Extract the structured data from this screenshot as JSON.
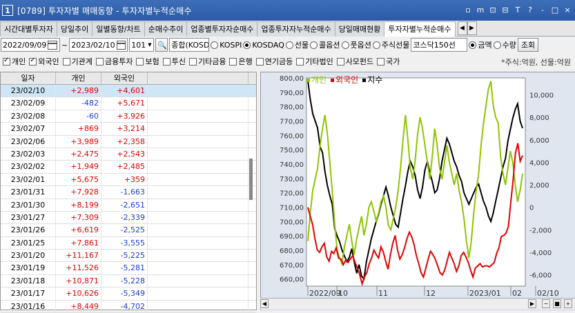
{
  "window": {
    "badge": "1",
    "title": "[0789] 투자자별 매매동향 - 투자자별누적순매수",
    "controls": [
      "▫",
      "m",
      "⊡",
      "⊟",
      "T",
      "?",
      "-",
      "□",
      "×"
    ]
  },
  "tabs": [
    "시간대별투자자",
    "당일추이",
    "일별동향/차트",
    "순매수추이",
    "업종별투자자순매수",
    "업종투자자누적순매수",
    "당일매매현황",
    "투자자별누적순매수"
  ],
  "active_tab": 7,
  "controls": {
    "date_from": "2022/09/09",
    "tilde": "~",
    "date_to": "2023/02/10",
    "code": "101",
    "market_select": "종합(KOSD",
    "radios": [
      {
        "label": "KOSPI",
        "on": false
      },
      {
        "label": "KOSDAQ",
        "on": true
      },
      {
        "label": "선물",
        "on": false
      },
      {
        "label": "콜옵션",
        "on": false
      },
      {
        "label": "풋옵션",
        "on": false
      },
      {
        "label": "주식선물",
        "on": false
      }
    ],
    "sector_select": "코스닥150선",
    "value_radios": [
      {
        "label": "금액",
        "on": true
      },
      {
        "label": "수량",
        "on": false
      }
    ],
    "query_button": "조회"
  },
  "checkboxes": [
    {
      "label": "개인",
      "on": true
    },
    {
      "label": "외국인",
      "on": true
    },
    {
      "label": "기관계",
      "on": false
    },
    {
      "label": "금융투자",
      "on": false
    },
    {
      "label": "보험",
      "on": false
    },
    {
      "label": "투신",
      "on": false
    },
    {
      "label": "기타금융",
      "on": false
    },
    {
      "label": "은행",
      "on": false
    },
    {
      "label": "연기금등",
      "on": false
    },
    {
      "label": "기타법인",
      "on": false
    },
    {
      "label": "사모펀드",
      "on": false
    },
    {
      "label": "국가",
      "on": false
    }
  ],
  "unit_note": "*주식:억원, 선물:억원",
  "table": {
    "headers": [
      "일자",
      "개인",
      "외국인"
    ],
    "rows": [
      {
        "date": "23/02/10",
        "ind": "+2,989",
        "frn": "+4,601"
      },
      {
        "date": "23/02/09",
        "ind": "-482",
        "frn": "+5,671"
      },
      {
        "date": "23/02/08",
        "ind": "-60",
        "frn": "+3,926"
      },
      {
        "date": "23/02/07",
        "ind": "+869",
        "frn": "+3,214"
      },
      {
        "date": "23/02/06",
        "ind": "+3,989",
        "frn": "+2,358"
      },
      {
        "date": "23/02/03",
        "ind": "+2,475",
        "frn": "+2,543"
      },
      {
        "date": "23/02/02",
        "ind": "+1,949",
        "frn": "+2,485"
      },
      {
        "date": "23/02/01",
        "ind": "+5,675",
        "frn": "+359"
      },
      {
        "date": "23/01/31",
        "ind": "+7,928",
        "frn": "-1,663"
      },
      {
        "date": "23/01/30",
        "ind": "+8,199",
        "frn": "-2,651"
      },
      {
        "date": "23/01/27",
        "ind": "+7,309",
        "frn": "-2,339"
      },
      {
        "date": "23/01/26",
        "ind": "+6,619",
        "frn": "-2,525"
      },
      {
        "date": "23/01/25",
        "ind": "+7,861",
        "frn": "-3,555"
      },
      {
        "date": "23/01/20",
        "ind": "+11,167",
        "frn": "-5,225"
      },
      {
        "date": "23/01/19",
        "ind": "+11,526",
        "frn": "-5,281"
      },
      {
        "date": "23/01/18",
        "ind": "+10,871",
        "frn": "-5,228"
      },
      {
        "date": "23/01/17",
        "ind": "+10,626",
        "frn": "-5,349"
      },
      {
        "date": "23/01/16",
        "ind": "+8,449",
        "frn": "-4,702"
      }
    ]
  },
  "chart_data": {
    "type": "line",
    "legend": [
      "개인",
      "외국인",
      "지수"
    ],
    "colors": {
      "개인": "#8fc400",
      "외국인": "#e00000",
      "지수": "#000000"
    },
    "left_axis": {
      "ticks": [
        "800,00",
        "790,00",
        "780,00",
        "770,00",
        "760,00",
        "750,00",
        "740,00",
        "730,00",
        "720,00",
        "710,00",
        "700,00",
        "690,00",
        "680,00",
        "670,00",
        "660,00"
      ],
      "range": [
        655,
        800
      ]
    },
    "right_axis": {
      "ticks": [
        "10,000",
        "8,000",
        "6,000",
        "4,000",
        "2,000",
        "0",
        "-2,000",
        "-4,000",
        "-6,000"
      ],
      "range": [
        -7000,
        11500
      ]
    },
    "x_ticks": [
      "2022/09",
      "10",
      "11",
      "12",
      "2023/01",
      "02",
      "02/10"
    ],
    "series": [
      {
        "name": "지수",
        "axis": "left",
        "values": [
          798,
          785,
          775,
          770,
          765,
          752,
          748,
          735,
          725,
          718,
          712,
          695,
          690,
          686,
          680,
          676,
          672,
          675,
          681,
          672,
          664,
          670,
          662,
          660,
          672,
          680,
          688,
          694,
          700,
          705,
          712,
          718,
          724,
          718,
          710,
          704,
          698,
          696,
          706,
          716,
          725,
          735,
          742,
          738,
          732,
          722,
          716,
          724,
          736,
          742,
          734,
          728,
          720,
          722,
          730,
          742,
          750,
          758,
          754,
          748,
          742,
          738,
          732,
          728,
          720,
          716,
          712,
          716,
          720,
          724,
          726,
          720,
          714,
          710,
          704,
          700,
          706,
          714,
          722,
          730,
          738,
          744,
          756,
          764,
          772,
          778,
          782,
          770,
          765
        ]
      },
      {
        "name": "개인",
        "axis": "right",
        "values": [
          -3000,
          -500,
          1500,
          2500,
          3500,
          5500,
          7000,
          8200,
          6500,
          4000,
          1500,
          -1500,
          -3800,
          -4500,
          -5000,
          -3500,
          -2500,
          -1500,
          -3000,
          -4200,
          -2800,
          -1800,
          -800,
          -2500,
          -1500,
          0,
          500,
          -300,
          -1200,
          -500,
          500,
          1000,
          0,
          -1600,
          -2000,
          -1000,
          0,
          1500,
          3500,
          6000,
          8200,
          6000,
          3500,
          2500,
          4200,
          6500,
          8000,
          7000,
          5500,
          4000,
          2500,
          4500,
          7000,
          5500,
          3500,
          2500,
          4000,
          5500,
          4000,
          3000,
          2000,
          3000,
          1500,
          500,
          -1000,
          -3000,
          -4500,
          -3000,
          -500,
          1500,
          3000,
          5500,
          7500,
          9000,
          10500,
          11200,
          9000,
          8000,
          7500,
          4500,
          3000,
          2000,
          3500,
          5000,
          4000,
          2000,
          500,
          1500,
          3000
        ]
      },
      {
        "name": "외국인",
        "axis": "right",
        "values": [
          0,
          -800,
          -1500,
          -2800,
          -3800,
          -4000,
          -3500,
          -3200,
          -4400,
          -4800,
          -3900,
          -4100,
          -3600,
          -4500,
          -4600,
          -5100,
          -4700,
          -4900,
          -4600,
          -4300,
          -4900,
          -5400,
          -6000,
          -6800,
          -6200,
          -5800,
          -5000,
          -4500,
          -3800,
          -4200,
          -4500,
          -3500,
          -4000,
          -4800,
          -5500,
          -4200,
          -3200,
          -2500,
          -3800,
          -4600,
          -4200,
          -3600,
          -2800,
          -2200,
          -2600,
          -3300,
          -4300,
          -5000,
          -5800,
          -6200,
          -5400,
          -4600,
          -3900,
          -4200,
          -4600,
          -5200,
          -5800,
          -6000,
          -5600,
          -4800,
          -4000,
          -4500,
          -5000,
          -5700,
          -5200,
          -4300,
          -4000,
          -4400,
          -4900,
          -5600,
          -6200,
          -5400,
          -5200,
          -5000,
          -5300,
          -5200,
          -5200,
          -5300,
          -5100,
          -4900,
          -4100,
          -3600,
          -2600,
          -2500,
          -2300,
          -1700,
          400,
          2400,
          4800,
          5700,
          4100,
          4600
        ]
      }
    ]
  }
}
